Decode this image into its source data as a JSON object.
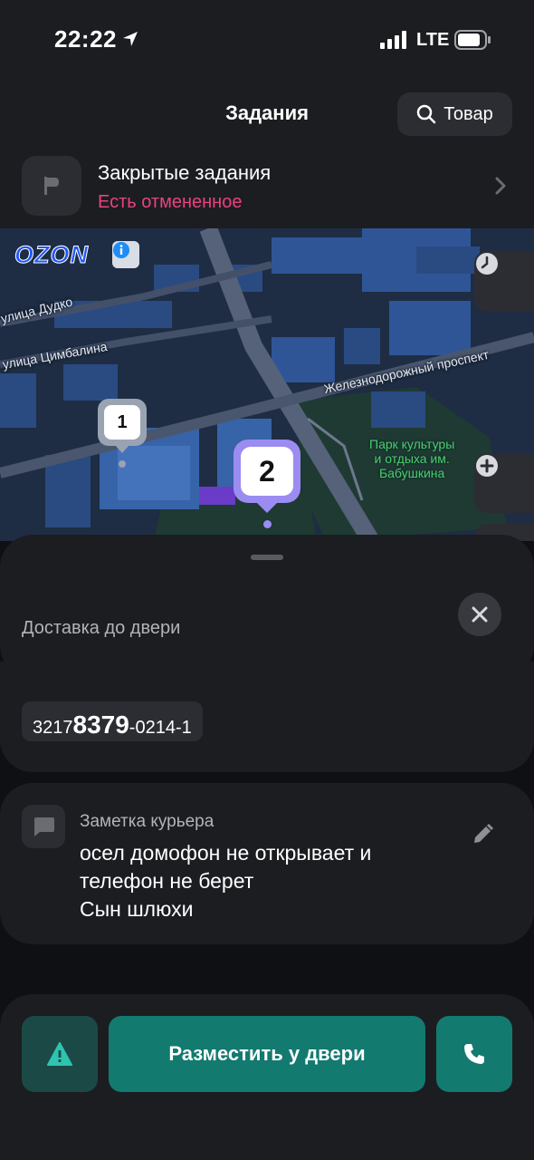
{
  "status_bar": {
    "time": "22:22",
    "network": "LTE"
  },
  "header": {
    "title": "Задания",
    "search_label": "Товар"
  },
  "closed_tasks": {
    "title": "Закрытые задания",
    "subtitle": "Есть отмененное"
  },
  "map": {
    "brand": "OZON",
    "streets": [
      "улица Дудко",
      "улица Цимбалина",
      "Железнодорожный проспект"
    ],
    "park": [
      "Парк культуры",
      "и отдыха им.",
      "Бабушкина"
    ],
    "pins": [
      "1",
      "2"
    ]
  },
  "sheet": {
    "delivery_type": "Доставка до двери"
  },
  "order": {
    "prefix": "3217",
    "highlight": "8379",
    "suffix": "-0214-1"
  },
  "note": {
    "title": "Заметка курьера",
    "text": "осел домофон не открывает и\nтелефон не берет\nСын шлюхи"
  },
  "actions": {
    "place_label": "Разместить у двери"
  },
  "colors": {
    "accent_teal": "#137a70",
    "cancel_pink": "#e8437c",
    "pin_purple": "#9b8cf2"
  },
  "icons": [
    "location-arrow-icon",
    "signal-icon",
    "battery-icon",
    "search-icon",
    "flag-icon",
    "chevron-right-icon",
    "info-icon",
    "clock-icon",
    "plus-icon",
    "close-icon",
    "comment-icon",
    "pencil-icon",
    "warning-icon",
    "phone-icon"
  ]
}
